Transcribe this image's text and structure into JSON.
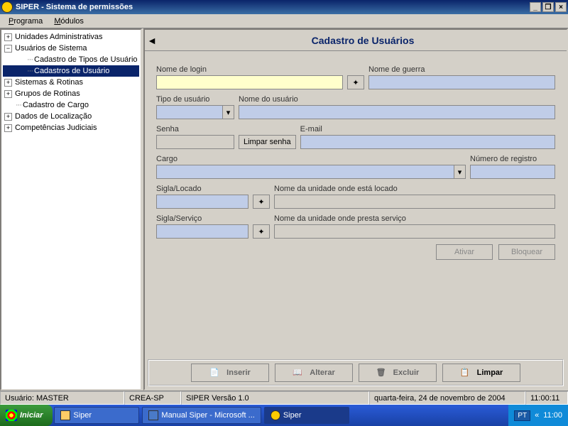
{
  "window": {
    "title": "SIPER - Sistema de permissões"
  },
  "menu": {
    "programa": "Programa",
    "modulos": "Módulos"
  },
  "tree": {
    "n0": "Unidades Administrativas",
    "n1": "Usuários de Sistema",
    "n1a": "Cadastro de Tipos de Usuário",
    "n1b": "Cadastros de Usuário",
    "n2": "Sistemas & Rotinas",
    "n3": "Grupos de Rotinas",
    "n4": "Cadastro de Cargo",
    "n5": "Dados de Localização",
    "n6": "Competências Judiciais"
  },
  "panel": {
    "title": "Cadastro de Usuários",
    "labels": {
      "nome_login": "Nome de login",
      "nome_guerra": "Nome de guerra",
      "tipo_usuario": "Tipo de usuário",
      "nome_usuario": "Nome do usuário",
      "senha": "Senha",
      "limpar_senha": "Limpar senha",
      "email": "E-mail",
      "cargo": "Cargo",
      "num_registro": "Número de registro",
      "sigla_locado": "Sigla/Locado",
      "nome_unidade_locado": "Nome da unidade onde está locado",
      "sigla_servico": "Sigla/Serviço",
      "nome_unidade_servico": "Nome da unidade onde presta serviço"
    },
    "buttons": {
      "ativar": "Ativar",
      "bloquear": "Bloquear"
    }
  },
  "toolbar": {
    "inserir": "Inserir",
    "alterar": "Alterar",
    "excluir": "Excluir",
    "limpar": "Limpar"
  },
  "status": {
    "usuario_label": "Usuário:  MASTER",
    "org": "CREA-SP",
    "version": "SIPER Versão 1.0",
    "date": "quarta-feira, 24 de novembro de 2004",
    "time": "11:00:11"
  },
  "taskbar": {
    "start": "Iniciar",
    "t1": "Siper",
    "t2": "Manual Siper - Microsoft ...",
    "t3": "Siper",
    "lang": "PT",
    "clock": "11:00"
  }
}
